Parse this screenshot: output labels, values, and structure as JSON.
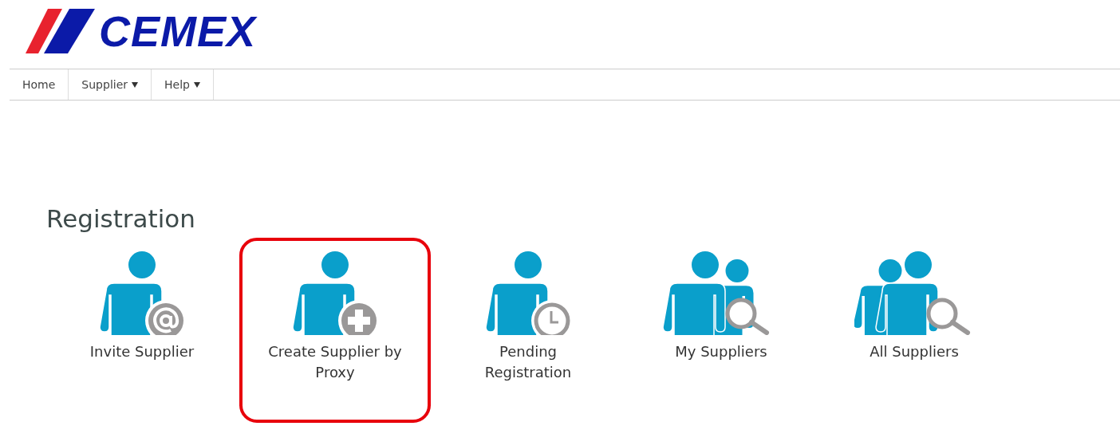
{
  "logo": {
    "text": "CEMEX"
  },
  "nav": [
    {
      "label": "Home",
      "dropdown": false
    },
    {
      "label": "Supplier",
      "dropdown": true
    },
    {
      "label": "Help",
      "dropdown": true
    }
  ],
  "section": {
    "title": "Registration"
  },
  "tiles": [
    {
      "label": "Invite Supplier",
      "kind": "invite",
      "highlighted": false
    },
    {
      "label": "Create Supplier by Proxy",
      "kind": "create",
      "highlighted": true
    },
    {
      "label": "Pending Registration",
      "kind": "pending",
      "highlighted": false
    },
    {
      "label": "My Suppliers",
      "kind": "mine",
      "highlighted": false
    },
    {
      "label": "All Suppliers",
      "kind": "all",
      "highlighted": false
    }
  ]
}
